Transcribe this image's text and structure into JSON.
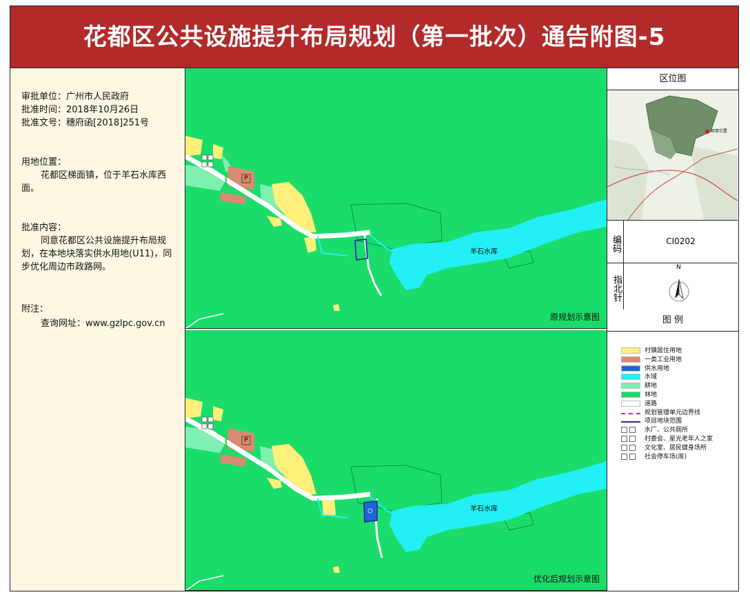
{
  "title": "花都区公共设施提升布局规划（第一批次）通告附图-5",
  "info": {
    "approval_unit": "审批单位：广州市人民政府",
    "approval_time": "批准时间：2018年10月26日",
    "approval_doc": "批准文号：穗府函[2018]251号",
    "location_label": "用地位置：",
    "location_text": "花都区梯面镇，位于羊石水库西面。",
    "content_label": "批准内容：",
    "content_text": "同意花都区公共设施提升布局规划，在本地块落实供水用地(U11)，同步优化周边市政路网。",
    "note_label": "附注：",
    "note_text": "查询网址：www.gzlpc.gov.cn"
  },
  "maps": {
    "original_label": "原规划示意图",
    "optimized_label": "优化后规划示意图",
    "reservoir_label": "羊石水库",
    "parking_symbol": "P"
  },
  "side": {
    "location_map_title": "区位图",
    "location_marker": "项目位置",
    "code_label": "编码",
    "code_value": "CI0202",
    "north_label": "指北针",
    "north_letter": "N",
    "legend_title": "图  例"
  },
  "legend": [
    {
      "label": "村镇居住用地",
      "color": "#fef07a",
      "kind": "fill"
    },
    {
      "label": "一类工业用地",
      "color": "#d98a70",
      "kind": "fill"
    },
    {
      "label": "供水用地",
      "color": "#1e66d6",
      "kind": "fill"
    },
    {
      "label": "水域",
      "color": "#22f0f4",
      "kind": "fill"
    },
    {
      "label": "耕地",
      "color": "#7ff0b0",
      "kind": "fill"
    },
    {
      "label": "林地",
      "color": "#1bdc6a",
      "kind": "fill"
    },
    {
      "label": "道路",
      "color": "#ffffff",
      "kind": "fill"
    },
    {
      "label": "规划管理单元边界线",
      "color": "#d01cc8",
      "kind": "dash"
    },
    {
      "label": "项目地块范围",
      "color": "#2330a0",
      "kind": "line"
    },
    {
      "label": "水厂、公共厕所",
      "color": "#555555",
      "kind": "icon"
    },
    {
      "label": "村委会、星光老年人之家",
      "color": "#555555",
      "kind": "icon"
    },
    {
      "label": "文化室、居民健身场所",
      "color": "#555555",
      "kind": "icon"
    },
    {
      "label": "社会停车场(库)",
      "color": "#555555",
      "kind": "icon"
    }
  ]
}
